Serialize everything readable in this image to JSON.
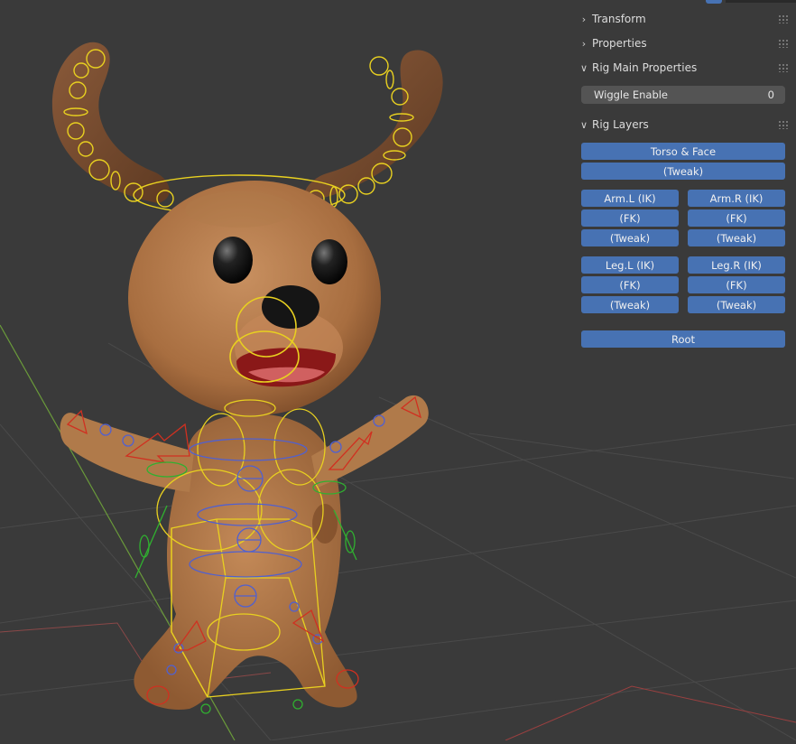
{
  "sidebar": {
    "panels": [
      {
        "label": "Transform",
        "expanded": false
      },
      {
        "label": "Properties",
        "expanded": false
      },
      {
        "label": "Rig Main Properties",
        "expanded": true
      },
      {
        "label": "Rig Layers",
        "expanded": true
      }
    ],
    "rig_main": {
      "wiggle_label": "Wiggle Enable",
      "wiggle_value": "0"
    },
    "rig_layers": {
      "torso_face": "Torso & Face",
      "torso_tweak": "(Tweak)",
      "arm_l_ik": "Arm.L (IK)",
      "arm_r_ik": "Arm.R (IK)",
      "arm_l_fk": "(FK)",
      "arm_r_fk": "(FK)",
      "arm_l_tweak": "(Tweak)",
      "arm_r_tweak": "(Tweak)",
      "leg_l_ik": "Leg.L (IK)",
      "leg_r_ik": "Leg.R (IK)",
      "leg_l_fk": "(FK)",
      "leg_r_fk": "(FK)",
      "leg_l_tweak": "(Tweak)",
      "leg_r_tweak": "(Tweak)",
      "root": "Root"
    }
  },
  "colors": {
    "viewport_bg": "#3a3a3a",
    "button_blue": "#4772b3",
    "field_bg": "#545454",
    "bone_yellow": "#e8d020",
    "bone_blue": "#5060d0",
    "bone_red": "#d03020",
    "bone_green": "#30b030",
    "fur_brown": "#b27a4a"
  },
  "icons": [
    "chevron-right-icon",
    "chevron-down-icon",
    "drag-grip-icon"
  ]
}
